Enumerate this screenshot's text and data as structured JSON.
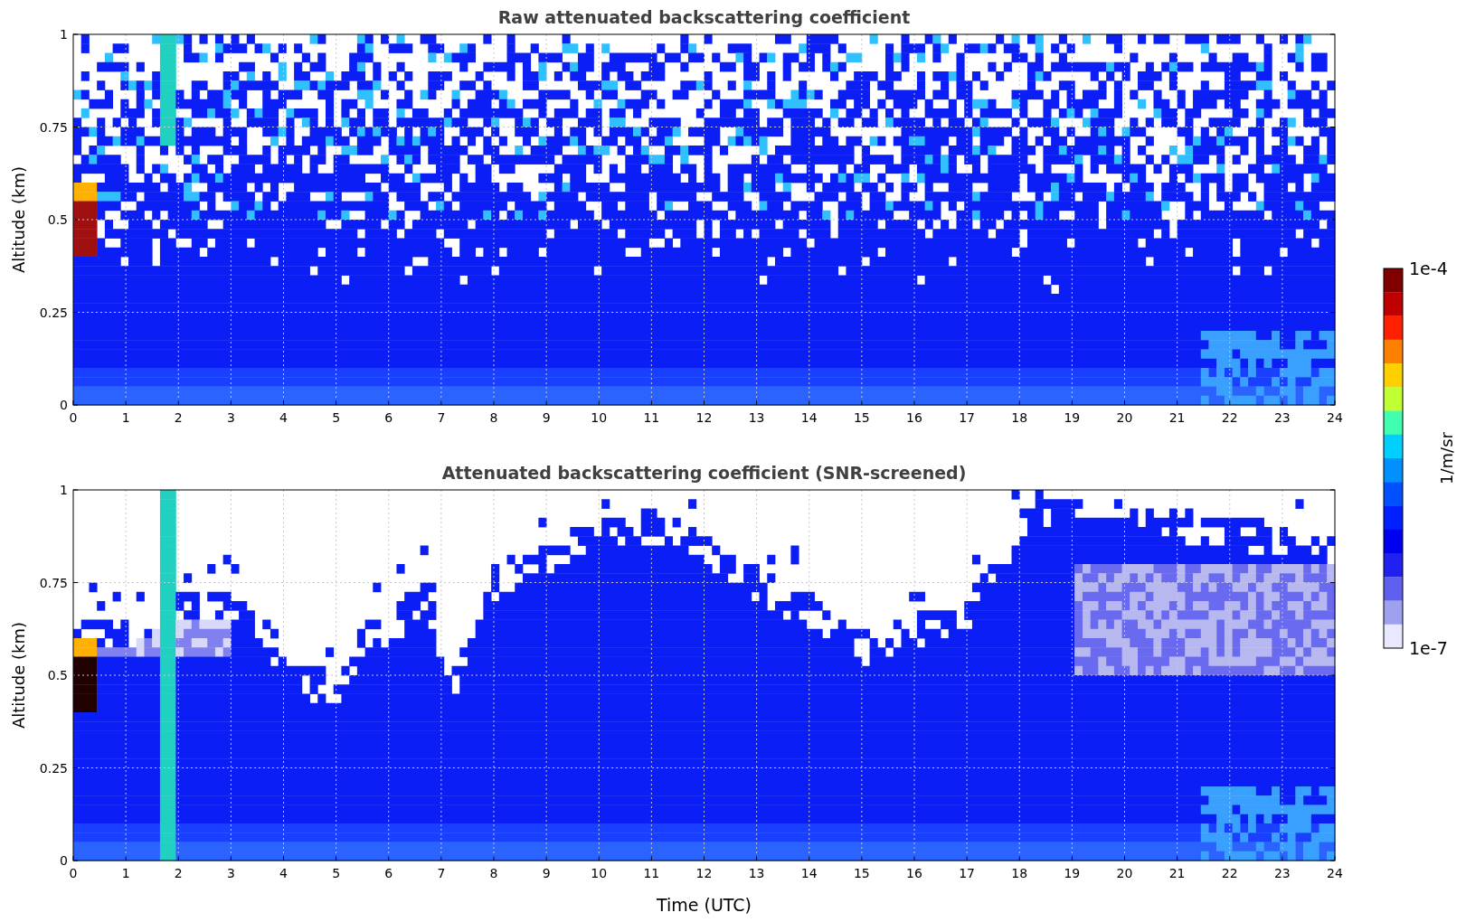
{
  "panels": [
    {
      "kind": "raw",
      "title": "Raw attenuated backscattering coefficient",
      "ylabel": "Altitude (km)",
      "yticks": [
        "1",
        "0.75",
        "0.5",
        "0.25",
        "0"
      ],
      "xticks": [
        "0",
        "1",
        "2",
        "3",
        "4",
        "5",
        "6",
        "7",
        "8",
        "9",
        "10",
        "11",
        "12",
        "13",
        "14",
        "15",
        "16",
        "17",
        "18",
        "19",
        "20",
        "21",
        "22",
        "23",
        "24"
      ]
    },
    {
      "kind": "screened",
      "title": "Attenuated backscattering coefficient (SNR-screened)",
      "ylabel": "Altitude (km)",
      "yticks": [
        "1",
        "0.75",
        "0.5",
        "0.25",
        "0"
      ],
      "xticks": [
        "0",
        "1",
        "2",
        "3",
        "4",
        "5",
        "6",
        "7",
        "8",
        "9",
        "10",
        "11",
        "12",
        "13",
        "14",
        "15",
        "16",
        "17",
        "18",
        "19",
        "20",
        "21",
        "22",
        "23",
        "24"
      ],
      "xlabel": "Time (UTC)"
    }
  ],
  "colorbar": {
    "label": "1/m/sr",
    "max_label": "1e-4",
    "min_label": "1e-7"
  }
}
